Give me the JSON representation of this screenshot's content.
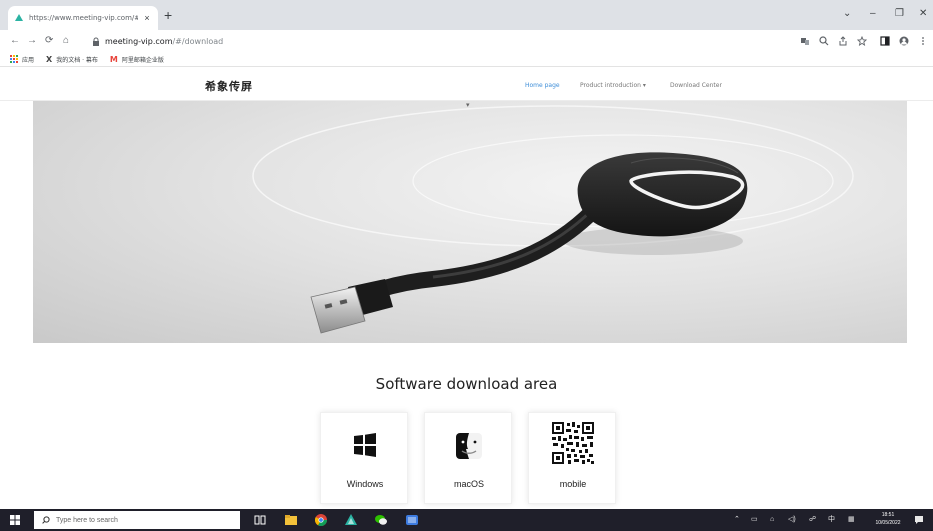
{
  "browser": {
    "tab_title": "https://www.meeting-vip.com/#/do",
    "tab_close": "×",
    "new_tab": "+",
    "window_controls": [
      "⌄",
      "–",
      "❐",
      "✕"
    ],
    "nav": {
      "back": "←",
      "forward": "→",
      "reload": "⟳",
      "home": "⌂"
    },
    "url_host": "meeting-vip.com",
    "url_path": "/#/download",
    "bookmarks": [
      {
        "icon": "apps-grid-icon",
        "label": "应用"
      },
      {
        "icon": "x-bookmark-icon",
        "label": "我的文档 · 幕布"
      },
      {
        "icon": "mail-m-icon",
        "label": "阿里邮箱企业版"
      }
    ]
  },
  "site": {
    "brand": "希象传屏",
    "nav": {
      "home": "Home page",
      "products": "Product introduction ▾",
      "download": "Download Center"
    },
    "scroll_caret": "▾",
    "section_title": "Software download area",
    "downloads": [
      {
        "label": "Windows",
        "icon": "windows-logo-icon"
      },
      {
        "label": "macOS",
        "icon": "finder-logo-icon"
      },
      {
        "label": "mobile",
        "icon": "qr-code-icon"
      }
    ]
  },
  "taskbar": {
    "search_placeholder": "Type here to search",
    "tray": [
      "⌃",
      "▭",
      "⌂",
      "◁)",
      "☍",
      "中",
      "▦"
    ],
    "time": "18:51",
    "date": "10/05/2022"
  },
  "colors": {
    "accent_link": "#3e8ed8",
    "taskbar": "#1f1f2a",
    "tab_strip": "#dee1e6"
  }
}
